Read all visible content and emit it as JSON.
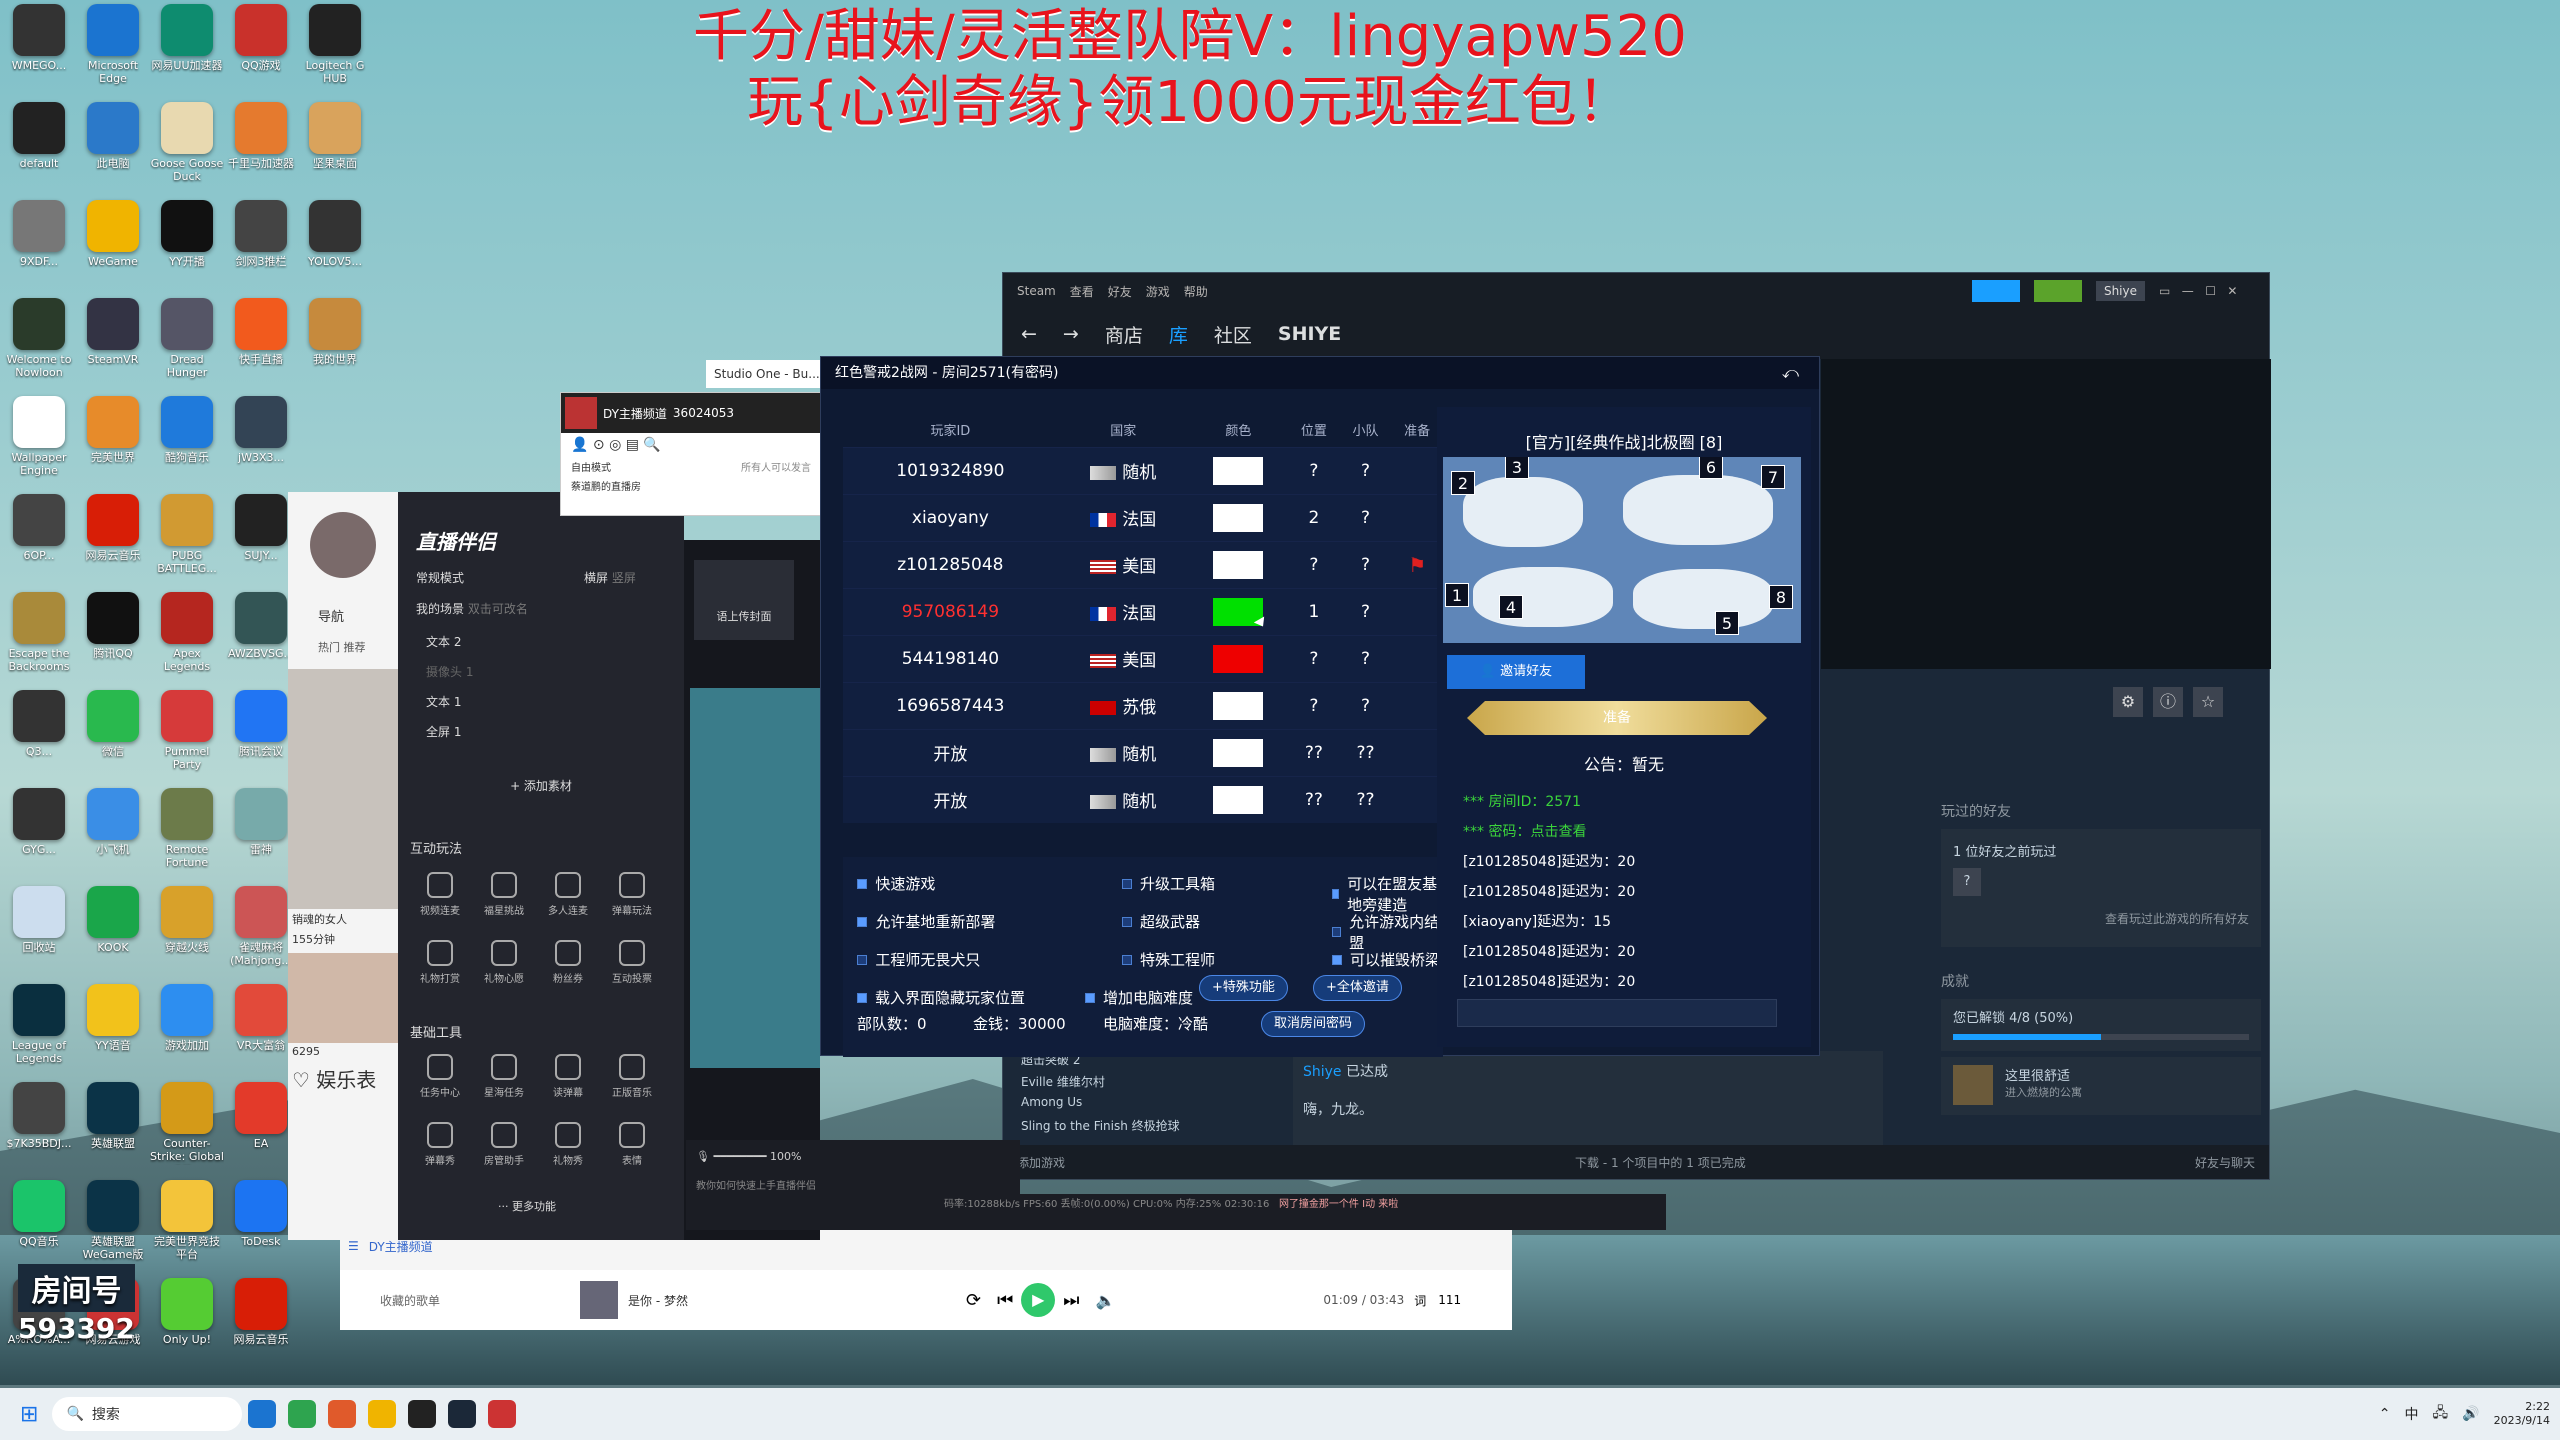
{
  "banner": {
    "line1": "千分/甜妹/灵活整队陪V：lingyapw520",
    "line2": "玩{心剑奇缘}领1000元现金红包！"
  },
  "desktop_icons": [
    {
      "label": "WMEGO...",
      "color": "#333"
    },
    {
      "label": "Microsoft Edge",
      "color": "#1b74d0"
    },
    {
      "label": "网易UU加速器",
      "color": "#0e8c6f"
    },
    {
      "label": "QQ游戏",
      "color": "#c9312b"
    },
    {
      "label": "Logitech G HUB",
      "color": "#222"
    },
    {
      "label": "default",
      "color": "#222"
    },
    {
      "label": "此电脑",
      "color": "#2b79c9"
    },
    {
      "label": "Goose Goose Duck",
      "color": "#e8d9b0"
    },
    {
      "label": "千里马加速器",
      "color": "#e57a2e"
    },
    {
      "label": "坚果桌面",
      "color": "#d9a35c"
    },
    {
      "label": "9XDF...",
      "color": "#777"
    },
    {
      "label": "WeGame",
      "color": "#f0b400"
    },
    {
      "label": "YY开播",
      "color": "#111"
    },
    {
      "label": "剑网3推栏",
      "color": "#444"
    },
    {
      "label": "YOLOV5...",
      "color": "#333"
    },
    {
      "label": "Welcome to Nowloon",
      "color": "#2a3b2a"
    },
    {
      "label": "SteamVR",
      "color": "#334"
    },
    {
      "label": "Dread Hunger",
      "color": "#556"
    },
    {
      "label": "快手直播",
      "color": "#f25a1d"
    },
    {
      "label": "我的世界",
      "color": "#c68a3d"
    },
    {
      "label": "Wallpaper Engine",
      "color": "#fff"
    },
    {
      "label": "完美世界",
      "color": "#e78b2a"
    },
    {
      "label": "酷狗音乐",
      "color": "#1f7adb"
    },
    {
      "label": "jW3X3...",
      "color": "#345"
    },
    {
      "label": "6OP...",
      "color": "#444"
    },
    {
      "label": "网易云音乐",
      "color": "#d81e06"
    },
    {
      "label": "PUBG BATTLEG...",
      "color": "#d19a32"
    },
    {
      "label": "SUJY...",
      "color": "#222"
    },
    {
      "label": "Escape the Backrooms",
      "color": "#a98a3a"
    },
    {
      "label": "腾讯QQ",
      "color": "#111"
    },
    {
      "label": "Apex Legends",
      "color": "#b5261f"
    },
    {
      "label": "AWZBVSG...",
      "color": "#355"
    },
    {
      "label": "Q3...",
      "color": "#333"
    },
    {
      "label": "微信",
      "color": "#29b94e"
    },
    {
      "label": "Pummel Party",
      "color": "#d63a3a"
    },
    {
      "label": "腾讯会议",
      "color": "#2175f3"
    },
    {
      "label": "GYG...",
      "color": "#333"
    },
    {
      "label": "小飞机",
      "color": "#3a8ee6"
    },
    {
      "label": "Remote Fortune",
      "color": "#6c7b4a"
    },
    {
      "label": "雷神",
      "color": "#7aa"
    },
    {
      "label": "回收站",
      "color": "#cde"
    },
    {
      "label": "KOOK",
      "color": "#1aa64a"
    },
    {
      "label": "穿越火线",
      "color": "#d8a12a"
    },
    {
      "label": "雀魂麻将 (Mahjong...",
      "color": "#c55"
    },
    {
      "label": "League of Legends",
      "color": "#0a2f3f"
    },
    {
      "label": "YY语音",
      "color": "#f2c21b"
    },
    {
      "label": "游戏加加",
      "color": "#2d8ef0"
    },
    {
      "label": "VR大富翁",
      "color": "#e24a3a"
    },
    {
      "label": "$7K35BDJ...",
      "color": "#444"
    },
    {
      "label": "英雄联盟",
      "color": "#0b3347"
    },
    {
      "label": "Counter-Strike: Global Off...",
      "color": "#d49a18"
    },
    {
      "label": "EA",
      "color": "#e33a2a"
    },
    {
      "label": "QQ音乐",
      "color": "#1bc46a"
    },
    {
      "label": "英雄联盟WeGame版",
      "color": "#0b3347"
    },
    {
      "label": "完美世界竞技平台",
      "color": "#f3c43a"
    },
    {
      "label": "ToDesk",
      "color": "#1c74f2"
    },
    {
      "label": "A%RO%A...",
      "color": "#444"
    },
    {
      "label": "网易云游戏",
      "color": "#c33"
    },
    {
      "label": "Only Up!",
      "color": "#5c3"
    },
    {
      "label": "网易云音乐",
      "color": "#d81e06"
    }
  ],
  "room_number": {
    "label": "房间号",
    "value": "593392"
  },
  "steam": {
    "menu": [
      "Steam",
      "查看",
      "好友",
      "游戏",
      "帮助"
    ],
    "nav": [
      "商店",
      "库",
      "社区",
      "SHIYE"
    ],
    "active_nav": "库",
    "user": "Shiye",
    "friends_played": "玩过的好友",
    "friends_count": "1 位好友之前玩过",
    "see_all": "查看玩过此游戏的所有好友",
    "achievements": "成就",
    "achieve_progress": "您已解锁 4/8 (50%)",
    "achieve_fraction": 0.5,
    "achieve_item": "这里很舒适",
    "achieve_desc": "进入燃烧的公寓",
    "activity": [
      {
        "name": "超击突破 2"
      },
      {
        "name": "Eville 维维尔村"
      },
      {
        "name": "Among Us"
      },
      {
        "name": "Sling to the Finish 终极抢球"
      }
    ],
    "activity_user": "Shiye",
    "activity_text": "已达成",
    "activity_item": "嗨，九龙。",
    "add_game": "添加游戏",
    "downloads": "下载 - 1 个项目中的 1 项已完成",
    "friends_chat": "好友与聊天"
  },
  "room": {
    "title": "红色警戒2战网 - 房间2571(有密码)",
    "headers": [
      "玩家ID",
      "国家",
      "颜色",
      "位置",
      "小队",
      "准备"
    ],
    "players": [
      {
        "id": "1019324890",
        "country": "随机",
        "color": "#ffffff",
        "pos": "?",
        "team": "?",
        "ready": "",
        "flag": "random"
      },
      {
        "id": "xiaoyany",
        "country": "法国",
        "color": "#ffffff",
        "pos": "2",
        "team": "?",
        "ready": "",
        "flag": "fr"
      },
      {
        "id": "z101285048",
        "country": "美国",
        "color": "#ffffff",
        "pos": "?",
        "team": "?",
        "ready": "flag",
        "flag": "us"
      },
      {
        "id": "957086149",
        "country": "法国",
        "color": "#00e000",
        "pos": "1",
        "team": "?",
        "ready": "",
        "flag": "fr",
        "idColor": "#ff3030"
      },
      {
        "id": "544198140",
        "country": "美国",
        "color": "#ee0000",
        "pos": "?",
        "team": "?",
        "ready": "",
        "flag": "us"
      },
      {
        "id": "1696587443",
        "country": "苏俄",
        "color": "#ffffff",
        "pos": "?",
        "team": "?",
        "ready": "",
        "flag": "su"
      },
      {
        "id": "开放",
        "country": "随机",
        "color": "#ffffff",
        "pos": "??",
        "team": "??",
        "ready": "",
        "flag": "random"
      },
      {
        "id": "开放",
        "country": "随机",
        "color": "#ffffff",
        "pos": "??",
        "team": "??",
        "ready": "",
        "flag": "random"
      }
    ],
    "options": [
      {
        "label": "快速游戏",
        "on": true
      },
      {
        "label": "升级工具箱",
        "on": false
      },
      {
        "label": "可以在盟友基地旁建造",
        "on": true
      },
      {
        "label": "允许基地重新部署",
        "on": true
      },
      {
        "label": "超级武器",
        "on": false
      },
      {
        "label": "允许游戏内结盟",
        "on": false
      },
      {
        "label": "工程师无畏犬只",
        "on": false
      },
      {
        "label": "特殊工程师",
        "on": false
      },
      {
        "label": "可以摧毁桥梁",
        "on": true
      },
      {
        "label": "载入界面隐藏玩家位置",
        "on": true
      },
      {
        "label": "增加电脑难度",
        "on": true
      }
    ],
    "btn_special": "+特殊功能",
    "btn_invite_all": "+全体邀请",
    "units": "部队数：0",
    "money": "金钱：30000",
    "difficulty": "电脑难度：冷酷",
    "cancel_pwd": "取消房间密码",
    "map_title": "[官方][经典作战]北极圈 [8]",
    "map_nums": [
      "2",
      "3",
      "6",
      "7",
      "1",
      "4",
      "5",
      "8"
    ],
    "invite": "邀请好友",
    "ready_btn": "准备",
    "notice": "公告：暂无",
    "chat": [
      {
        "text": "*** 房间ID：2571",
        "green": true
      },
      {
        "text": "*** 密码：点击查看",
        "green": true
      },
      {
        "text": "[z101285048]延迟为：20",
        "green": false
      },
      {
        "text": "[z101285048]延迟为：20",
        "green": false
      },
      {
        "text": "[xiaoyany]延迟为：15",
        "green": false
      },
      {
        "text": "[z101285048]延迟为：20",
        "green": false
      },
      {
        "text": "[z101285048]延迟为：20",
        "green": false
      }
    ]
  },
  "streamer": {
    "app": "直播伴侣",
    "mode": "常规模式",
    "tabs_top": [
      "横屏",
      "竖屏"
    ],
    "scene": "我的场景",
    "scene_tabs": [
      "双击",
      "可改名"
    ],
    "sources": [
      "文本 2",
      "摄像头 1",
      "文本 1",
      "全屏 1"
    ],
    "add_source": "+ 添加素材",
    "interact": "互动玩法",
    "interact_tools": [
      "视频连麦",
      "福星挑战",
      "多人连麦",
      "弹幕玩法",
      "礼物打赏",
      "礼物心愿",
      "粉丝券",
      "互动投票"
    ],
    "basic": "基础工具",
    "basic_tools": [
      "任务中心",
      "星海任务",
      "读弹幕",
      "正版音乐",
      "弹幕秀",
      "房管助手",
      "礼物秀",
      "表情"
    ],
    "more": "··· 更多功能",
    "upload": "语上传封面",
    "nav": "导航",
    "nav_tabs": [
      "热门",
      "推荐"
    ],
    "viewer1": "销魂的女人",
    "viewer1_count": "155分钟",
    "viewer2_count": "6295",
    "entertainment": "娱乐表",
    "volume": "100%",
    "tip": "教你如何快速上手直播伴侣",
    "stats": "码率:10288kb/s  FPS:60  丢帧:0(0.00%)  CPU:0%  内存:25%  02:30:16",
    "notice2": "网了撞金那一个件 Ⅰ动 来啦"
  },
  "dy": {
    "title": "DY主播频道",
    "id": "36024053",
    "mode": "自由模式",
    "mode2": "所有人可以发言",
    "row": "蔡道鹏的直播房",
    "footer": "DY主播频道"
  },
  "studio": {
    "title": "Studio One - Bu..."
  },
  "music": {
    "playlist": "收藏的歌单",
    "song": "是你 - 梦然",
    "time": "01:09 / 03:43",
    "lyric": "词",
    "count": "111"
  },
  "taskbar": {
    "search": "搜索",
    "time": "2:22",
    "date": "2023/9/14",
    "ime": "中"
  }
}
